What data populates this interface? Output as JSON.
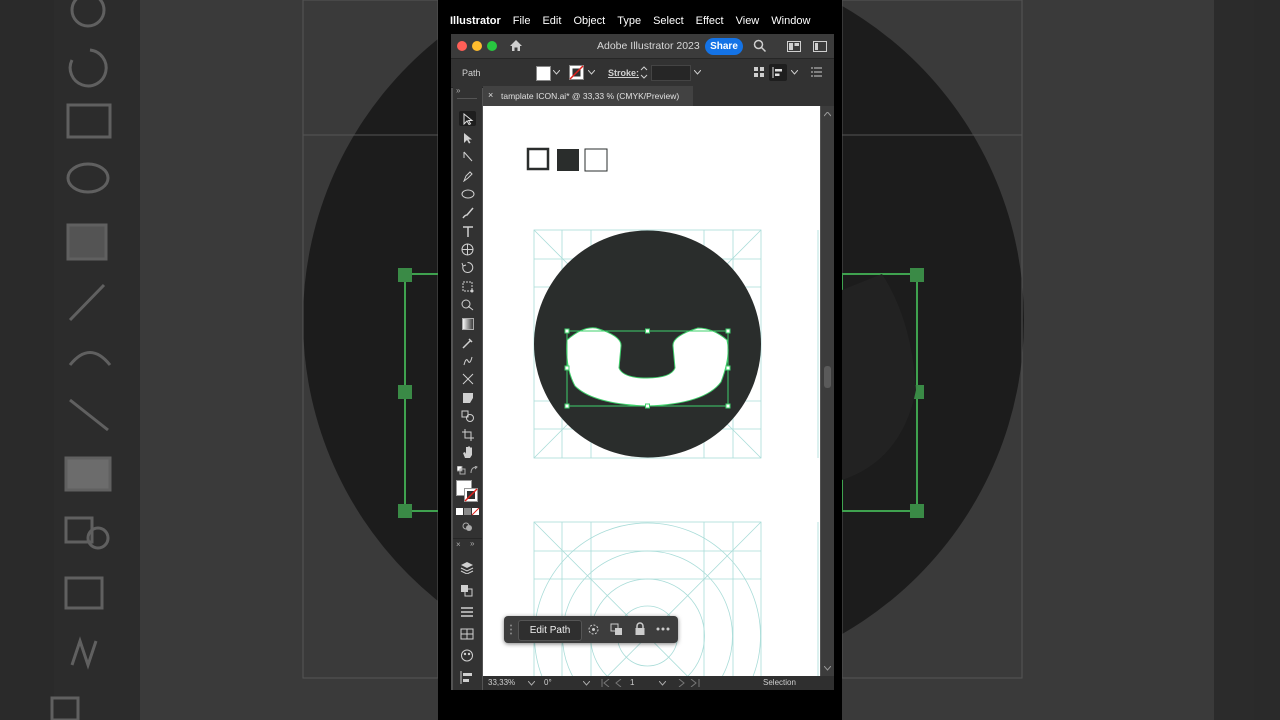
{
  "menubar": {
    "app": "Illustrator",
    "items": [
      "File",
      "Edit",
      "Object",
      "Type",
      "Select",
      "Effect",
      "View",
      "Window"
    ]
  },
  "titlebar": {
    "title": "Adobe Illustrator 2023",
    "share_label": "Share"
  },
  "controlbar": {
    "selection_type": "Path",
    "stroke_label": "Stroke:"
  },
  "document_tab": {
    "title": "tamplate ICON.ai* @ 33,33 % (CMYK/Preview)",
    "close_glyph": "×"
  },
  "toolbar": {
    "panel_glyph": "»"
  },
  "context_bar": {
    "edit_path_label": "Edit Path"
  },
  "statusbar": {
    "zoom": "33,33%",
    "rotation": "0°",
    "artboard": "1",
    "tool": "Selection"
  },
  "colors": {
    "icon_fill": "#2a2d2c",
    "selection_green": "#3fd06b",
    "guide_cyan": "#a9dcd8",
    "accent_blue": "#1473e6"
  }
}
